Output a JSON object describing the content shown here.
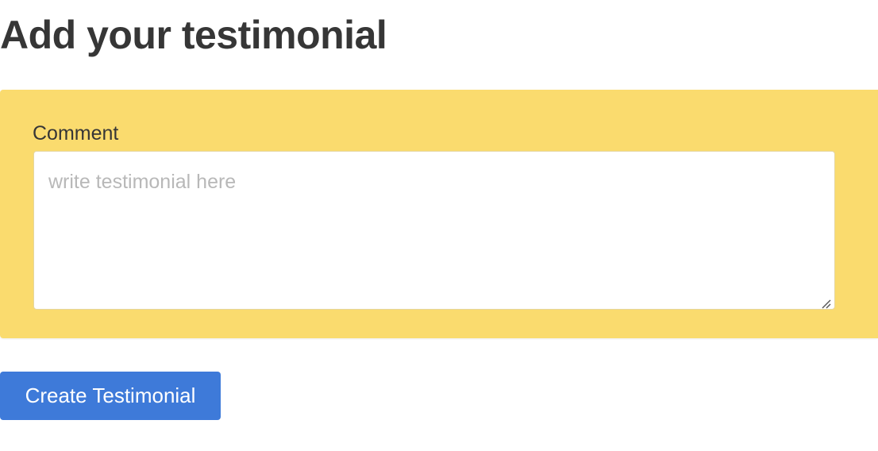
{
  "page": {
    "title": "Add your testimonial"
  },
  "form": {
    "panel_color": "#fadb6e",
    "comment": {
      "label": "Comment",
      "value": "",
      "placeholder": "write testimonial here"
    },
    "submit": {
      "label": "Create Testimonial",
      "color": "#3e7ad9"
    }
  },
  "icons": {
    "resize_handle": "resize-grip-icon"
  }
}
